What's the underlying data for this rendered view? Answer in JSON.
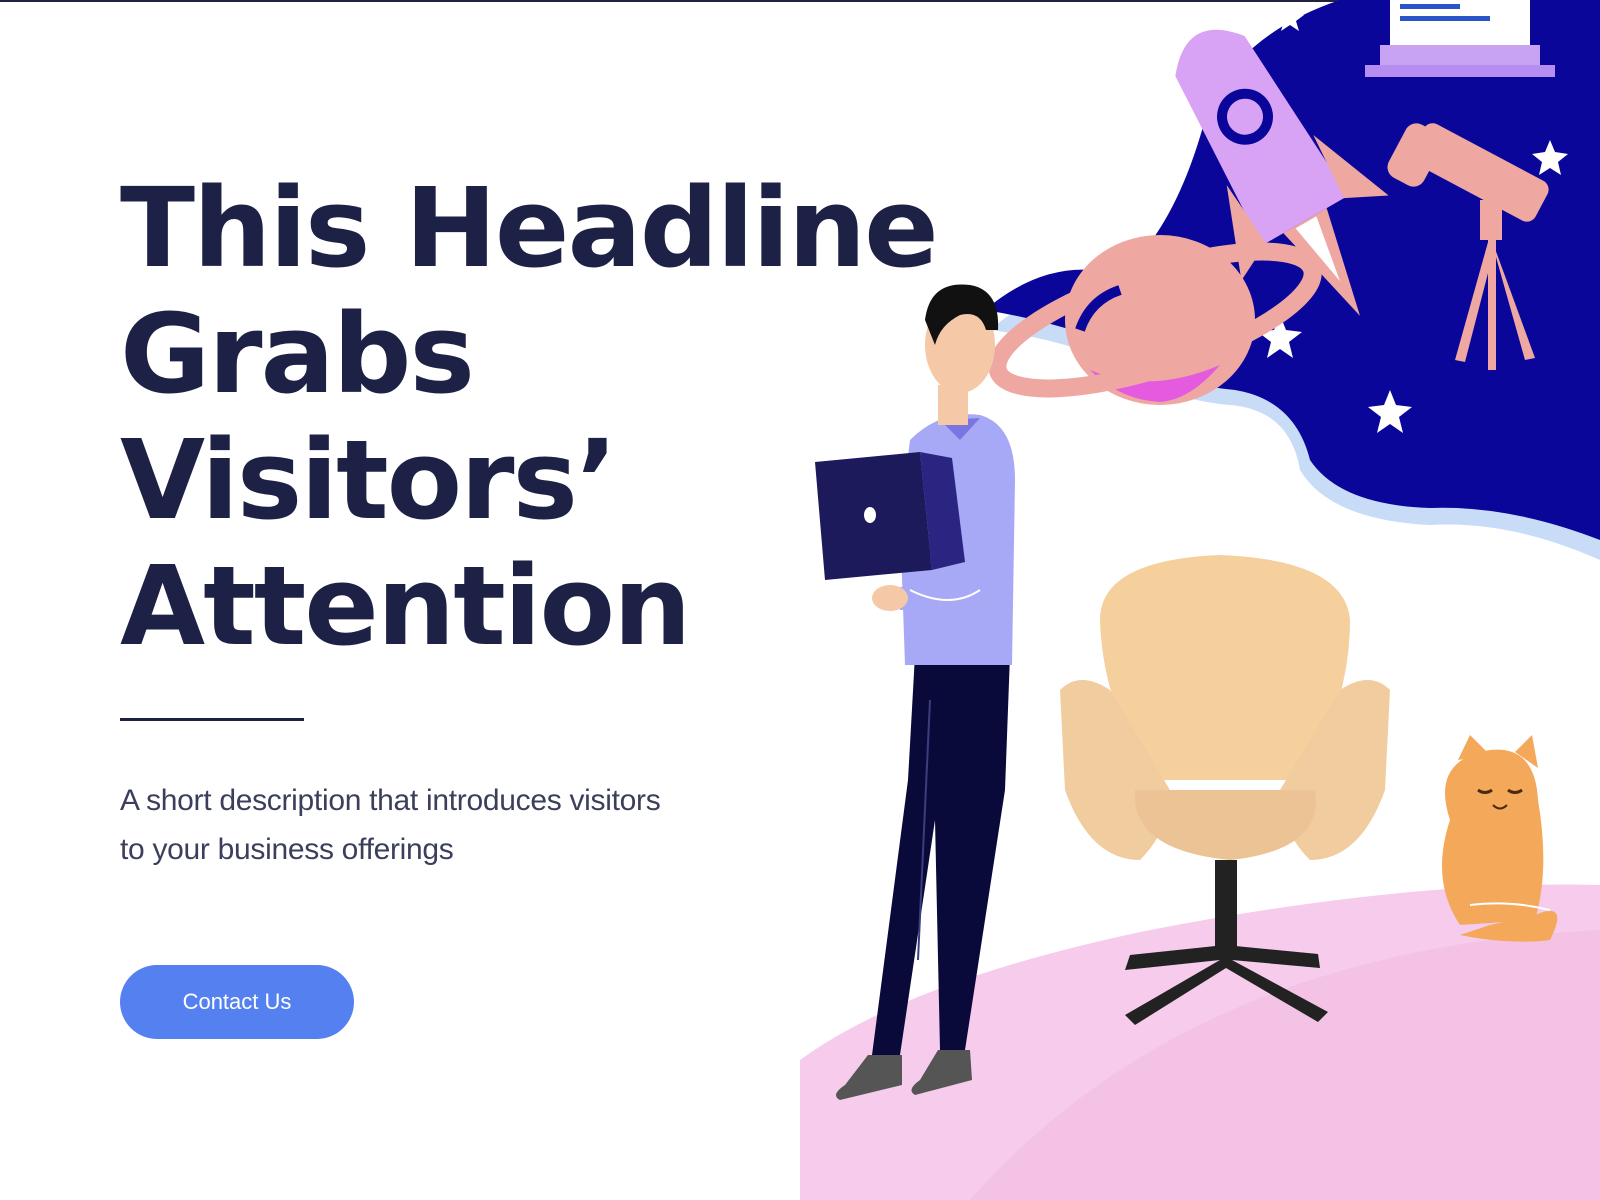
{
  "hero": {
    "headline_lines": [
      "This Headline",
      "Grabs",
      "Visitors’",
      "Attention"
    ],
    "description": "A short description that introduces visitors to your business offerings",
    "cta_label": "Contact Us"
  },
  "illustration": {
    "icons": [
      "person-icon",
      "laptop-icon",
      "rocket-icon",
      "planet-icon",
      "telescope-icon",
      "star-icon",
      "chair-icon",
      "cat-icon",
      "monitor-icon"
    ]
  },
  "colors": {
    "headline": "#1d2145",
    "cta_background": "#5580f0",
    "night_sky": "#0a0699",
    "floor": "#f5c9ea"
  }
}
